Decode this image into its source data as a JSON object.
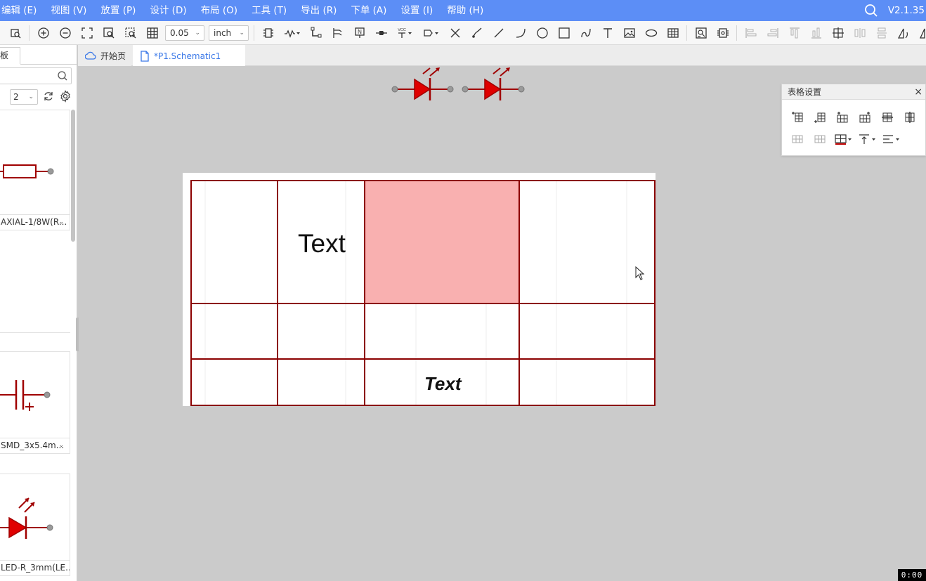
{
  "menu": {
    "items": [
      "编辑 (E)",
      "视图 (V)",
      "放置 (P)",
      "设计 (D)",
      "布局 (O)",
      "工具 (T)",
      "导出 (R)",
      "下单 (A)",
      "设置 (I)",
      "帮助 (H)"
    ],
    "version": "V2.1.35"
  },
  "toolbar": {
    "grid_value": "0.05",
    "unit": "inch"
  },
  "left_panel": {
    "tab_label": "板",
    "page_value": "2",
    "cards": [
      {
        "name": "AXIAL-1/8W(R...",
        "icon": "resistor-symbol"
      },
      {
        "name": "SMD_3x5.4m...",
        "icon": "capacitor-symbol"
      },
      {
        "name": "LED-R_3mm(LE...",
        "icon": "led-symbol"
      }
    ]
  },
  "tabs": {
    "start": "开始页",
    "schematic": "*P1.Schematic1"
  },
  "canvas": {
    "text_large": "Text",
    "text_bold": "Text",
    "selected_fill": "#f9b0b0",
    "table_border": "#8b0000"
  },
  "table_panel": {
    "title": "表格设置",
    "close": "×"
  },
  "timer": "0:00"
}
